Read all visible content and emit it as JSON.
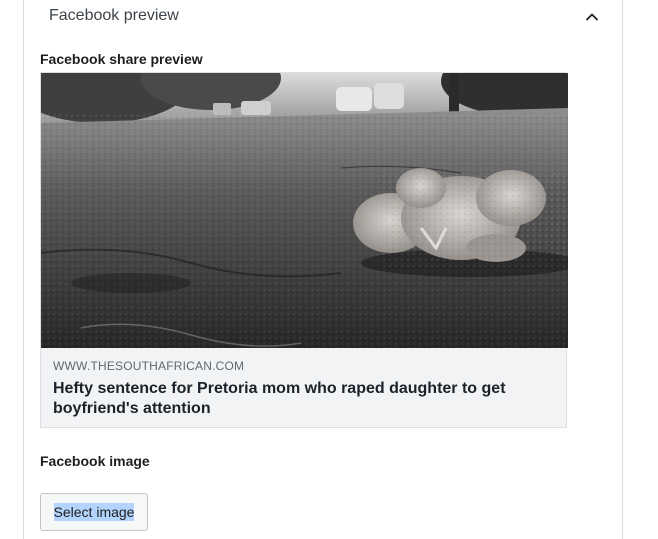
{
  "panel": {
    "title": "Facebook preview",
    "toggle_icon": "chevron-up-icon"
  },
  "share_preview": {
    "label": "Facebook share preview",
    "image_alt": "Teddy bear lying on a wet road",
    "domain": "WWW.THESOUTHAFRICAN.COM",
    "headline": "Hefty sentence for Pretoria mom who raped daughter to get boyfriend's attention"
  },
  "facebook_image": {
    "label": "Facebook image",
    "button_label": "Select image"
  },
  "colors": {
    "card_background": "#f2f3f5",
    "card_border": "#dddfe2",
    "domain_text": "#606770",
    "headline_text": "#1d2129",
    "text_selection": "#b3d4fc"
  }
}
